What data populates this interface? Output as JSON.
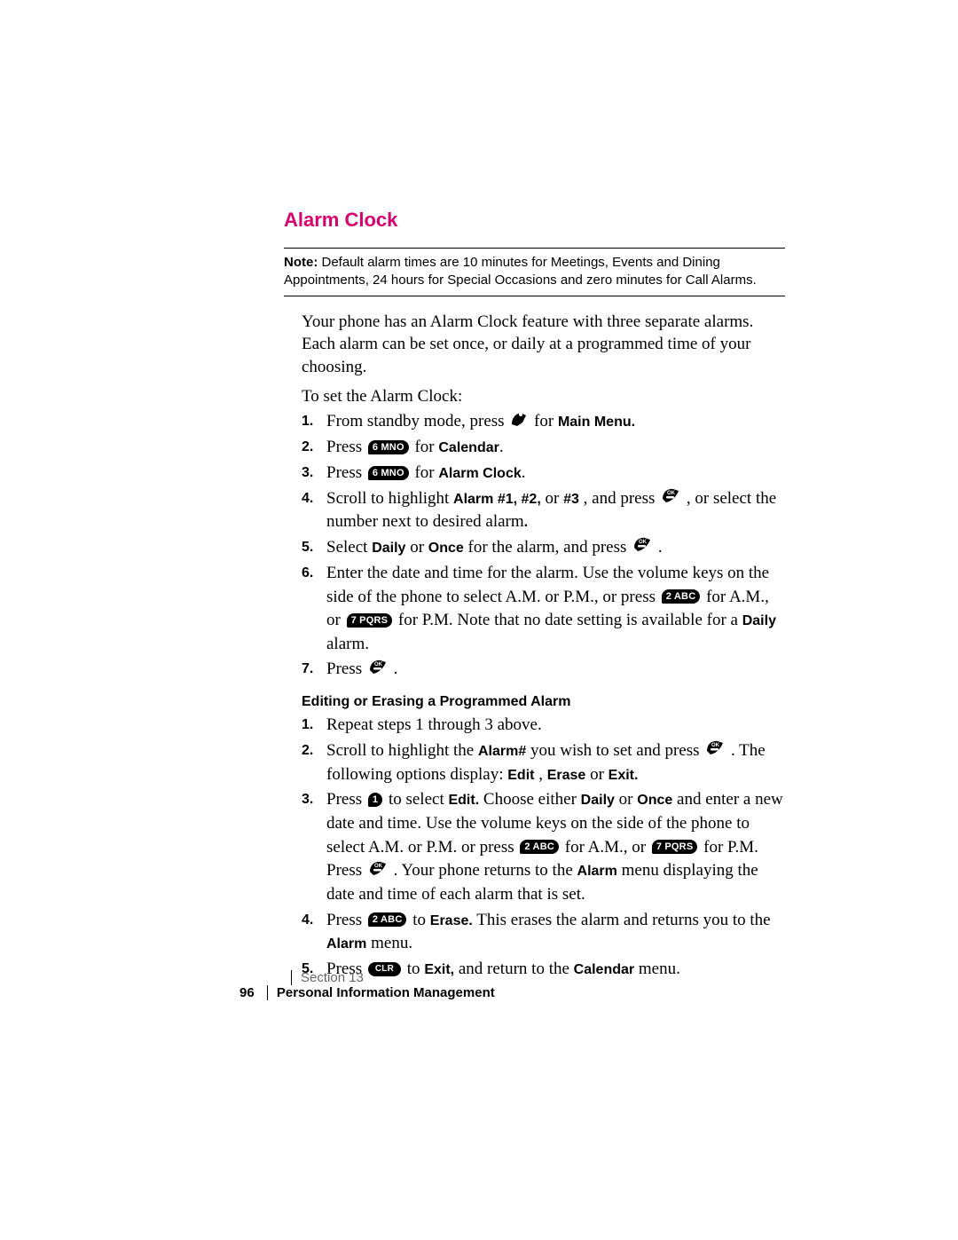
{
  "heading": "Alarm Clock",
  "note": {
    "label": "Note:",
    "text": "Default alarm times are 10 minutes for Meetings, Events and Dining Appointments, 24 hours for Special Occasions and zero minutes for Call Alarms."
  },
  "intro": "Your phone has an Alarm Clock feature with three separate alarms. Each alarm can be set once, or daily at a programmed time of your choosing.",
  "lead": "To set the Alarm Clock:",
  "steps": {
    "n1": "1.",
    "s1a": "From standby mode, press ",
    "s1b": " for ",
    "s1c": "Main Menu.",
    "n2": "2.",
    "s2a": "Press ",
    "s2b": " for ",
    "s2c": "Calendar",
    "s2d": ".",
    "n3": "3.",
    "s3a": "Press ",
    "s3b": " for ",
    "s3c": "Alarm Clock",
    "s3d": ".",
    "n4": "4.",
    "s4a": "Scroll to highlight ",
    "s4b": "Alarm #1, #2,",
    "s4c": " or ",
    "s4d": "#3",
    "s4e": ", and press ",
    "s4f": " , or select the number next to desired alarm",
    "s4g": ".",
    "n5": "5.",
    "s5a": "Select ",
    "s5b": "Daily",
    "s5c": " or ",
    "s5d": "Once",
    "s5e": " for the alarm, and press ",
    "s5f": " .",
    "n6": "6.",
    "s6a": "Enter the date and time for the alarm. Use the volume keys on the side of the phone to select A.M. or P.M., or press ",
    "s6b": " for A.M., or ",
    "s6c": " for P.M. Note that no date setting is available for a ",
    "s6d": "Daily",
    "s6e": " alarm.",
    "n7": "7.",
    "s7a": "Press ",
    "s7b": " ."
  },
  "subheading": "Editing or Erasing a Programmed Alarm",
  "esteps": {
    "n1": "1.",
    "e1": "Repeat steps 1 through 3 above.",
    "n2": "2.",
    "e2a": "Scroll to highlight the ",
    "e2b": "Alarm#",
    "e2c": " you wish to set and press ",
    "e2d": ". The following options display: ",
    "e2e": "Edit",
    "e2f": ", ",
    "e2g": "Erase",
    "e2h": " or ",
    "e2i": "Exit.",
    "n3": "3.",
    "e3a": "Press ",
    "e3b": " to select ",
    "e3c": "Edit.",
    "e3d": " Choose either ",
    "e3e": "Daily",
    "e3f": " or ",
    "e3g": "Once",
    "e3h": " and enter a new date and time. Use the volume keys on the side of the phone to select A.M. or P.M. or press ",
    "e3i": " for A.M., or ",
    "e3j": " for P.M. Press ",
    "e3k": " . Your phone returns to the ",
    "e3l": "Alarm",
    "e3m": " menu displaying the date and time of each alarm that is set.",
    "n4": "4.",
    "e4a": "Press ",
    "e4b": " to ",
    "e4c": "Erase.",
    "e4d": " This erases the alarm and returns you to the ",
    "e4e": "Alarm",
    "e4f": " menu.",
    "n5": "5.",
    "e5a": "Press ",
    "e5b": " to ",
    "e5c": "Exit,",
    "e5d": " and return to the ",
    "e5e": "Calendar",
    "e5f": " menu."
  },
  "keys": {
    "six": "6 MNO",
    "one": "1",
    "two": "2 ABC",
    "seven": "7 PQRS",
    "clr": "CLR"
  },
  "footer": {
    "section": "Section 13",
    "page": "96",
    "chapter": "Personal Information Management"
  }
}
